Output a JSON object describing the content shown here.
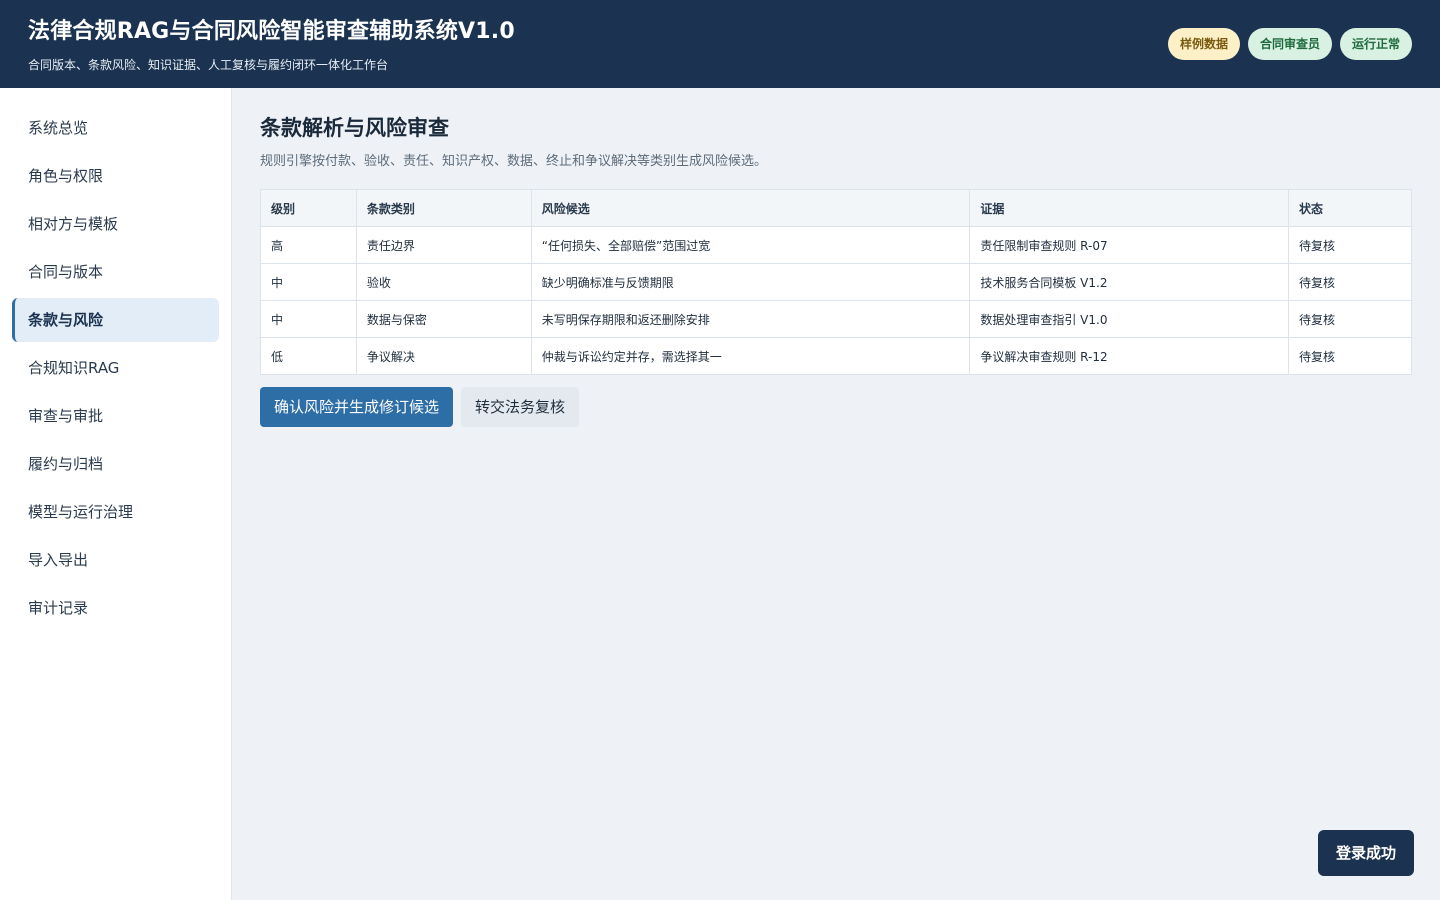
{
  "header": {
    "title": "法律合规RAG与合同风险智能审查辅助系统V1.0",
    "subtitle": "合同版本、条款风险、知识证据、人工复核与履约闭环一体化工作台",
    "badges": {
      "sample": "样例数据",
      "role": "合同审查员",
      "status": "运行正常"
    }
  },
  "sidebar": {
    "items": [
      {
        "label": "系统总览"
      },
      {
        "label": "角色与权限"
      },
      {
        "label": "相对方与模板"
      },
      {
        "label": "合同与版本"
      },
      {
        "label": "条款与风险"
      },
      {
        "label": "合规知识RAG"
      },
      {
        "label": "审查与审批"
      },
      {
        "label": "履约与归档"
      },
      {
        "label": "模型与运行治理"
      },
      {
        "label": "导入导出"
      },
      {
        "label": "审计记录"
      }
    ]
  },
  "main": {
    "title": "条款解析与风险审查",
    "description": "规则引擎按付款、验收、责任、知识产权、数据、终止和争议解决等类别生成风险候选。",
    "table": {
      "headers": {
        "level": "级别",
        "category": "条款类别",
        "risk": "风险候选",
        "evidence": "证据",
        "status": "状态"
      },
      "rows": [
        {
          "level": "高",
          "category": "责任边界",
          "risk": "“任何损失、全部赔偿”范围过宽",
          "evidence": "责任限制审查规则 R-07",
          "status": "待复核"
        },
        {
          "level": "中",
          "category": "验收",
          "risk": "缺少明确标准与反馈期限",
          "evidence": "技术服务合同模板 V1.2",
          "status": "待复核"
        },
        {
          "level": "中",
          "category": "数据与保密",
          "risk": "未写明保存期限和返还删除安排",
          "evidence": "数据处理审查指引 V1.0",
          "status": "待复核"
        },
        {
          "level": "低",
          "category": "争议解决",
          "risk": "仲裁与诉讼约定并存，需选择其一",
          "evidence": "争议解决审查规则 R-12",
          "status": "待复核"
        }
      ]
    },
    "actions": {
      "confirm": "确认风险并生成修订候选",
      "transfer": "转交法务复核"
    }
  },
  "toast": {
    "message": "登录成功"
  },
  "colors": {
    "header_bg": "#1b3350",
    "accent": "#2e6ea6",
    "level_high": "#b3261e",
    "level_mid": "#a06a00",
    "level_low": "#2e7d32"
  }
}
